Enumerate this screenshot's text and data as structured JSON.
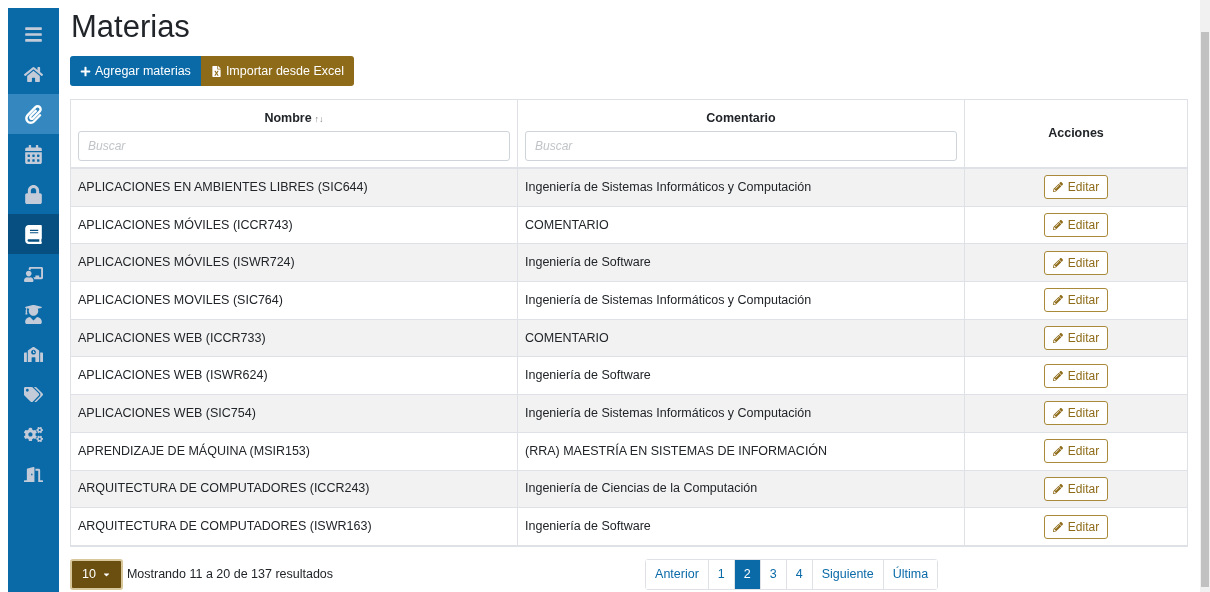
{
  "sidebar": {
    "items": [
      {
        "selected": false,
        "highlighted": false
      },
      {
        "selected": false,
        "highlighted": false
      },
      {
        "selected": false,
        "highlighted": true
      },
      {
        "selected": false,
        "highlighted": false
      },
      {
        "selected": false,
        "highlighted": false
      },
      {
        "selected": true,
        "highlighted": false
      },
      {
        "selected": false,
        "highlighted": false
      },
      {
        "selected": false,
        "highlighted": false
      },
      {
        "selected": false,
        "highlighted": false
      },
      {
        "selected": false,
        "highlighted": false
      },
      {
        "selected": false,
        "highlighted": false
      },
      {
        "selected": false,
        "highlighted": false
      }
    ]
  },
  "title": "Materias",
  "buttons": [
    {
      "label": "Agregar materias",
      "kind": "add"
    },
    {
      "label": "Importar desde Excel",
      "kind": "import"
    }
  ],
  "table": {
    "columns": [
      {
        "label": "Nombre",
        "sort": "↑↓",
        "placeholder": "Buscar"
      },
      {
        "label": "Comentario",
        "placeholder": "Buscar"
      },
      {
        "label": "Acciones"
      }
    ],
    "rows": [
      {
        "nombre": "APLICACIONES EN AMBIENTES LIBRES (SIC644)",
        "comentario": "Ingeniería de Sistemas Informáticos y Computación",
        "action": "Editar"
      },
      {
        "nombre": "APLICACIONES MÓVILES (ICCR743)",
        "comentario": "COMENTARIO",
        "action": "Editar"
      },
      {
        "nombre": "APLICACIONES MÓVILES (ISWR724)",
        "comentario": "Ingeniería de Software",
        "action": "Editar"
      },
      {
        "nombre": "APLICACIONES MOVILES (SIC764)",
        "comentario": "Ingeniería de Sistemas Informáticos y Computación",
        "action": "Editar"
      },
      {
        "nombre": "APLICACIONES WEB (ICCR733)",
        "comentario": "COMENTARIO",
        "action": "Editar"
      },
      {
        "nombre": "APLICACIONES WEB (ISWR624)",
        "comentario": "Ingeniería de Software",
        "action": "Editar"
      },
      {
        "nombre": "APLICACIONES WEB (SIC754)",
        "comentario": "Ingeniería de Sistemas Informáticos y Computación",
        "action": "Editar"
      },
      {
        "nombre": "APRENDIZAJE DE MÁQUINA (MSIR153)",
        "comentario": "(RRA) MAESTRÍA EN SISTEMAS DE INFORMACIÓN",
        "action": "Editar"
      },
      {
        "nombre": "ARQUITECTURA DE COMPUTADORES (ICCR243)",
        "comentario": "Ingeniería de Ciencias de la Computación",
        "action": "Editar"
      },
      {
        "nombre": "ARQUITECTURA DE COMPUTADORES (ISWR163)",
        "comentario": "Ingeniería de Software",
        "action": "Editar"
      }
    ]
  },
  "footer": {
    "page_size": "10",
    "summary": "Mostrando 11 a 20 de 137 resultados",
    "pagination": [
      {
        "label": "Anterior",
        "selected": false
      },
      {
        "label": "1",
        "selected": false
      },
      {
        "label": "2",
        "selected": true
      },
      {
        "label": "3",
        "selected": false
      },
      {
        "label": "4",
        "selected": false
      },
      {
        "label": "Siguiente",
        "selected": false
      },
      {
        "label": "Última",
        "selected": false
      }
    ]
  }
}
